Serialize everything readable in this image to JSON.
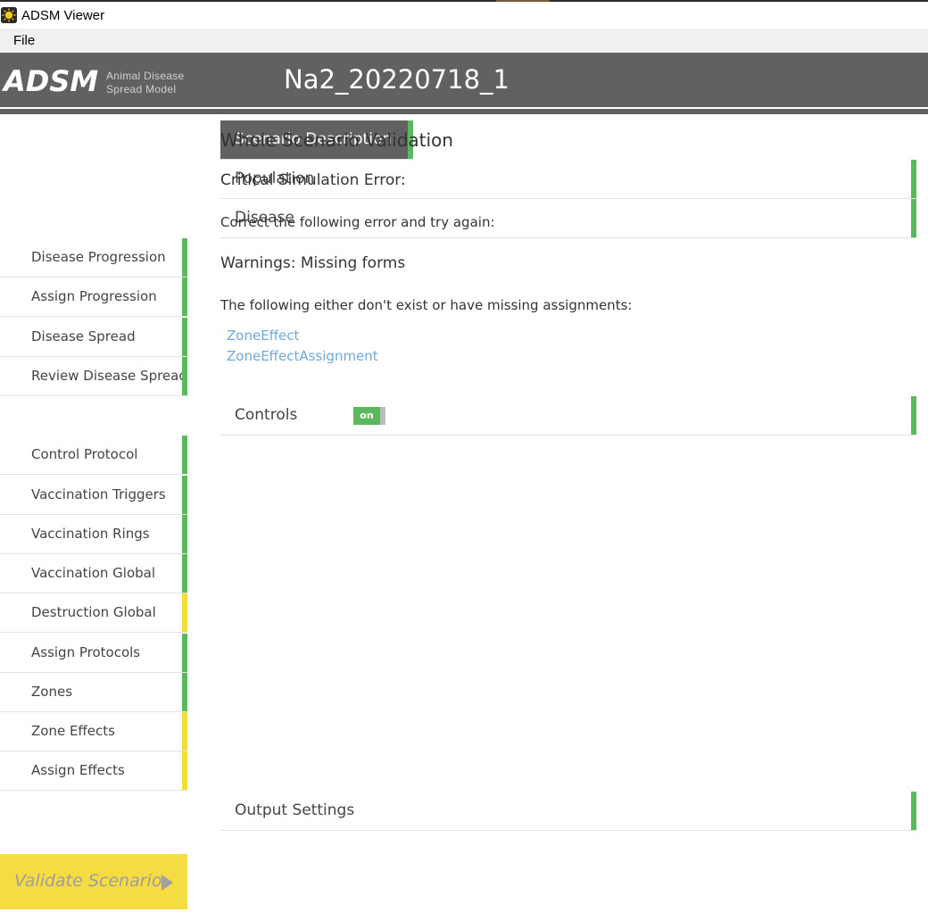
{
  "window": {
    "title": "ADSM Viewer",
    "icon": "sun-icon"
  },
  "menubar": {
    "items": [
      "File"
    ]
  },
  "header": {
    "logo": "ADSM",
    "logo_subtitle_line1": "Animal Disease",
    "logo_subtitle_line2": "Spread Model",
    "scenario_name": "Na2_20220718_1"
  },
  "colors": {
    "header_bg": "#616161",
    "ok": "#5cb85c",
    "warning": "#f3dc3c",
    "link": "#6fa8dc",
    "validate_bg": "#f5dc42"
  },
  "sidebar": {
    "items": [
      {
        "label": "Scenario Description",
        "level": "main",
        "status": "ok",
        "active": true
      },
      {
        "label": "Population",
        "level": "main",
        "status": "ok"
      },
      {
        "label": "Disease",
        "level": "main",
        "status": "ok"
      },
      {
        "label": "Disease Progression",
        "level": "sub",
        "status": "ok"
      },
      {
        "label": "Assign Progression",
        "level": "sub",
        "status": "ok"
      },
      {
        "label": "Disease Spread",
        "level": "sub",
        "status": "ok"
      },
      {
        "label": "Review Disease Spread",
        "level": "sub",
        "status": "ok"
      },
      {
        "label": "Controls",
        "level": "main",
        "status": "ok",
        "toggle": "on"
      },
      {
        "label": "Control Protocol",
        "level": "sub",
        "status": "ok"
      },
      {
        "label": "Vaccination Triggers",
        "level": "sub",
        "status": "ok"
      },
      {
        "label": "Vaccination Rings",
        "level": "sub",
        "status": "ok"
      },
      {
        "label": "Vaccination Global",
        "level": "sub",
        "status": "ok"
      },
      {
        "label": "Destruction Global",
        "level": "sub",
        "status": "warning"
      },
      {
        "label": "Assign Protocols",
        "level": "sub",
        "status": "ok"
      },
      {
        "label": "Zones",
        "level": "sub",
        "status": "ok"
      },
      {
        "label": "Zone Effects",
        "level": "sub",
        "status": "warning"
      },
      {
        "label": "Assign Effects",
        "level": "sub",
        "status": "warning"
      },
      {
        "label": "Output Settings",
        "level": "main",
        "status": "ok"
      }
    ],
    "validate_label": "Validate Scenario"
  },
  "main": {
    "title": "Whole Scenario Validation",
    "critical_heading": "Critical Simulation Error:",
    "critical_text": "Correct the following error and try again:",
    "warnings_heading": "Warnings: Missing forms",
    "warnings_text": "The following either don't exist or have missing assignments:",
    "missing": [
      "ZoneEffect",
      "ZoneEffectAssignment"
    ]
  }
}
